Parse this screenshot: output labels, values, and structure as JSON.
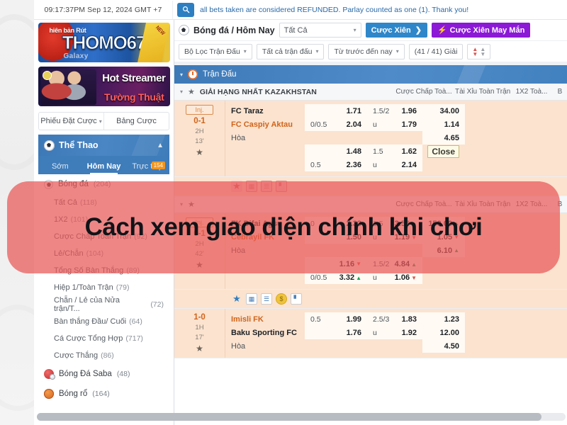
{
  "topbar": {
    "clock": "09:17:37PM Sep 12, 2024 GMT +7",
    "search_icon": "search-icon",
    "marquee": "all bets taken are considered REFUNDED. Parlay counted as one (1). Thank you!"
  },
  "banners": [
    {
      "small": "hiên bản Rút",
      "big": "THOMO67",
      "sub": "Galaxy",
      "corner": "NEW"
    },
    {
      "line1": "Hot Streamer",
      "line2": "Tường Thuật"
    }
  ],
  "bettabs": {
    "slip": "Phiếu Đặt Cược",
    "board": "Bảng Cược"
  },
  "sidebar": {
    "title": "Thể Thao",
    "tabs": [
      {
        "label": "Sớm",
        "active": false,
        "badge": ""
      },
      {
        "label": "Hôm Nay",
        "active": true,
        "badge": ""
      },
      {
        "label": "Trực tiếp",
        "active": false,
        "badge": "154"
      }
    ],
    "football": {
      "label": "Bóng đá",
      "count": "(204)"
    },
    "markets": [
      {
        "label": "Tất Cả",
        "count": "(118)"
      },
      {
        "label": "1X2",
        "count": "(101)"
      },
      {
        "label": "Cược Chấp Toàn Trận",
        "count": "(92)"
      },
      {
        "label": "Lẻ/Chẵn",
        "count": "(104)"
      },
      {
        "label": "Tổng Số Bàn Thắng",
        "count": "(89)"
      },
      {
        "label": "Hiệp 1/Toàn Trận",
        "count": "(79)"
      },
      {
        "label": "Chẵn / Lẻ của Nửa trận/T...",
        "count": "(72)"
      },
      {
        "label": "Bàn thắng Đầu/ Cuối",
        "count": "(64)"
      },
      {
        "label": "Cá Cược Tổng Hợp",
        "count": "(717)"
      },
      {
        "label": "Cược Thắng",
        "count": "(86)"
      }
    ],
    "sports": [
      {
        "label": "Bóng Đá Saba",
        "count": "(48)",
        "icon": "saba-football-icon"
      },
      {
        "label": "Bóng rổ",
        "count": "(164)",
        "icon": "basketball-icon"
      }
    ]
  },
  "sportbar": {
    "breadcrumb": "Bóng đá / Hôm Nay",
    "select_all": "Tất Cả",
    "parlay_button": "Cược Xiên",
    "lucky_parlay_button": "Cược Xiên May Mắn"
  },
  "filterbar": {
    "match_filter": "Bộ Lọc Trận Đấu",
    "all_matches": "Tất cả trận đấu",
    "time_range": "Từ trước đến nay",
    "leagues": "(41 / 41) Giải"
  },
  "matchheader": {
    "label": "Trận Đấu"
  },
  "leagues": [
    {
      "name": "GIẢI HẠNG NHẤT KAZAKHSTAN",
      "columns": [
        "Cược Chấp Toà...",
        "Tài Xỉu Toàn Trận",
        "1X2 Toà...",
        "B"
      ]
    },
    {
      "name": "",
      "columns": [
        "Cược Chấp Toà...",
        "Tài Xỉu Toàn Trận",
        "1X2 Toà...",
        "B"
      ]
    }
  ],
  "matches": [
    {
      "status_badge": "Inj.",
      "score": "0-1",
      "period": "2H",
      "minute": "13'",
      "home": "FC Taraz",
      "away": "FC Caspiy Aktau",
      "draw": "Hòa",
      "rows": [
        {
          "hcp_line": "",
          "hcp_odd": "1.71",
          "ou_line": "1.5/2",
          "ou_odd": "1.96",
          "x2": "34.00"
        },
        {
          "hcp_line": "0/0.5",
          "hcp_odd": "2.04",
          "ou_line": "u",
          "ou_odd": "1.79",
          "x2": "1.14"
        },
        {
          "hcp_line": "",
          "hcp_odd": "",
          "ou_line": "",
          "ou_odd": "",
          "x2": "4.65"
        }
      ],
      "rows2": [
        {
          "hcp_line": "",
          "hcp_odd": "1.48",
          "ou_line": "1.5",
          "ou_odd": "1.62",
          "x2": "Close"
        },
        {
          "hcp_line": "0.5",
          "hcp_odd": "2.36",
          "ou_line": "u",
          "ou_odd": "2.14",
          "x2": ""
        }
      ]
    },
    {
      "status_badge": "Inj.",
      "score": "0-1",
      "period": "2H",
      "minute": "42'",
      "home": "FK Difai Agsu",
      "away": "Cebrayil FK",
      "draw": "Hòa",
      "rows": [
        {
          "hcp_line": "0",
          "hcp_odd": "2.33",
          "ou_line": "1.5",
          "ou_odd": "3.56",
          "ou_dir": "up",
          "x2": "150.00",
          "x2_dir": "up"
        },
        {
          "hcp_line": "",
          "hcp_odd": "1.50",
          "ou_line": "u",
          "ou_odd": "1.19",
          "ou_dir": "dn",
          "x2": "1.05",
          "x2_dir": "dn"
        },
        {
          "hcp_line": "",
          "hcp_odd": "",
          "ou_line": "",
          "ou_odd": "",
          "x2": "6.10",
          "x2_dir": "up"
        }
      ],
      "rows2": [
        {
          "hcp_line": "",
          "hcp_odd": "1.16",
          "hcp_dir": "dn",
          "ou_line": "1.5/2",
          "ou_odd": "4.84",
          "ou_dir": "up",
          "x2": ""
        },
        {
          "hcp_line": "0/0.5",
          "hcp_odd": "3.32",
          "hcp_dir": "up",
          "ou_line": "u",
          "ou_odd": "1.06",
          "ou_dir": "dn",
          "x2": ""
        }
      ]
    },
    {
      "status_badge": "",
      "score": "1-0",
      "period": "1H",
      "minute": "17'",
      "home": "Imisli FK",
      "away": "Baku Sporting FC",
      "draw": "Hòa",
      "rows": [
        {
          "hcp_line": "0.5",
          "hcp_odd": "1.99",
          "ou_line": "2.5/3",
          "ou_odd": "1.83",
          "x2": "1.23"
        },
        {
          "hcp_line": "",
          "hcp_odd": "1.76",
          "ou_line": "u",
          "ou_odd": "1.92",
          "x2": "12.00"
        },
        {
          "hcp_line": "",
          "hcp_odd": "",
          "ou_line": "",
          "ou_odd": "",
          "x2": "4.50"
        }
      ],
      "rows2": []
    }
  ],
  "action_icons": [
    "star-icon",
    "pitch-icon",
    "list-icon",
    "coin-icon",
    "stats-icon"
  ],
  "overlay": {
    "text": "Cách xem giao diện chính khi chơi",
    "color": "#e95858"
  }
}
